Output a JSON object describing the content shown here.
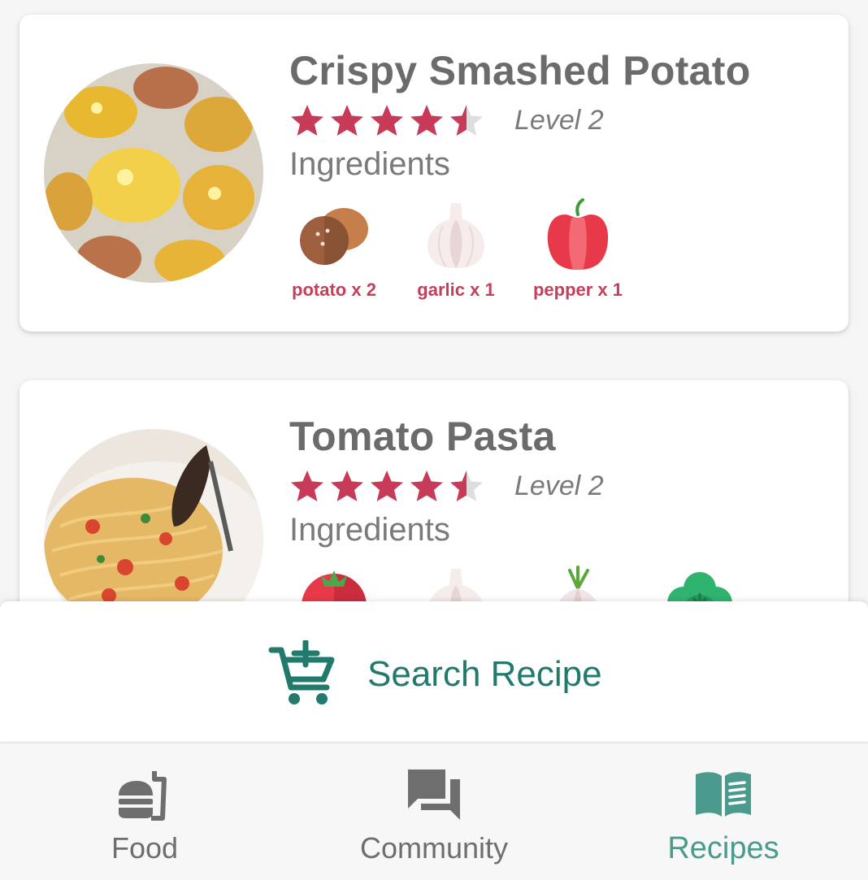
{
  "colors": {
    "star_filled": "#c73a58",
    "star_empty": "#dedede",
    "ingredient_label": "#c2405a",
    "accent_teal": "#217a6c",
    "nav_active": "#4a9a8e",
    "nav_inactive": "#6e6e6e"
  },
  "recipes": [
    {
      "title": "Crispy Smashed Potato",
      "rating": 4.5,
      "rating_max": 5,
      "level": "Level 2",
      "ingredients_label": "Ingredients",
      "ingredients": [
        {
          "label": "potato x 2",
          "icon": "potato-icon"
        },
        {
          "label": "garlic x 1",
          "icon": "garlic-icon"
        },
        {
          "label": "pepper x 1",
          "icon": "pepper-icon"
        }
      ]
    },
    {
      "title": "Tomato Pasta",
      "rating": 4.5,
      "rating_max": 5,
      "level": "Level 2",
      "ingredients_label": "Ingredients",
      "ingredients": [
        {
          "icon": "tomato-icon"
        },
        {
          "icon": "garlic-icon"
        },
        {
          "icon": "onion-icon"
        },
        {
          "icon": "basil-icon"
        }
      ]
    }
  ],
  "search": {
    "label": "Search Recipe",
    "icon": "cart-plus-icon"
  },
  "nav": {
    "items": [
      {
        "label": "Food",
        "icon": "food-icon",
        "active": false
      },
      {
        "label": "Community",
        "icon": "chat-icon",
        "active": false
      },
      {
        "label": "Recipes",
        "icon": "book-icon",
        "active": true
      }
    ]
  }
}
